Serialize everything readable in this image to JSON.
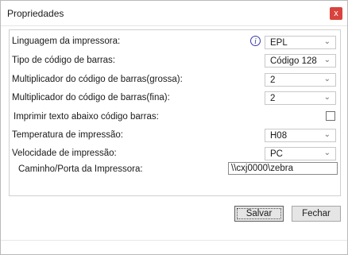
{
  "window": {
    "title": "Propriedades",
    "close_glyph": "x"
  },
  "fields": [
    {
      "label": "Linguagem da impressora:",
      "value": "EPL"
    },
    {
      "label": "Tipo de código de barras:",
      "value": "Código 128"
    },
    {
      "label": "Multiplicador do código de barras(grossa):",
      "value": "2"
    },
    {
      "label": "Multiplicador do código de barras(fina):",
      "value": "2"
    },
    {
      "label": "Imprimir texto abaixo código barras:",
      "checked": false
    },
    {
      "label": "Temperatura de impressão:",
      "value": "H08"
    },
    {
      "label": "Velocidade de impressão:",
      "value": "PC"
    },
    {
      "label": "Caminho/Porta da Impressora:",
      "value": "\\\\cxj0000\\zebra"
    }
  ],
  "icons": {
    "info": "info-icon",
    "chevron": "chevron-down-icon",
    "info_glyph": "i",
    "chevron_glyph": "⌄"
  },
  "buttons": {
    "save_label": "Salvar",
    "close_label": "Fechar"
  },
  "colors": {
    "close_button": "#d9433d",
    "info_icon": "#3a3aa8"
  }
}
